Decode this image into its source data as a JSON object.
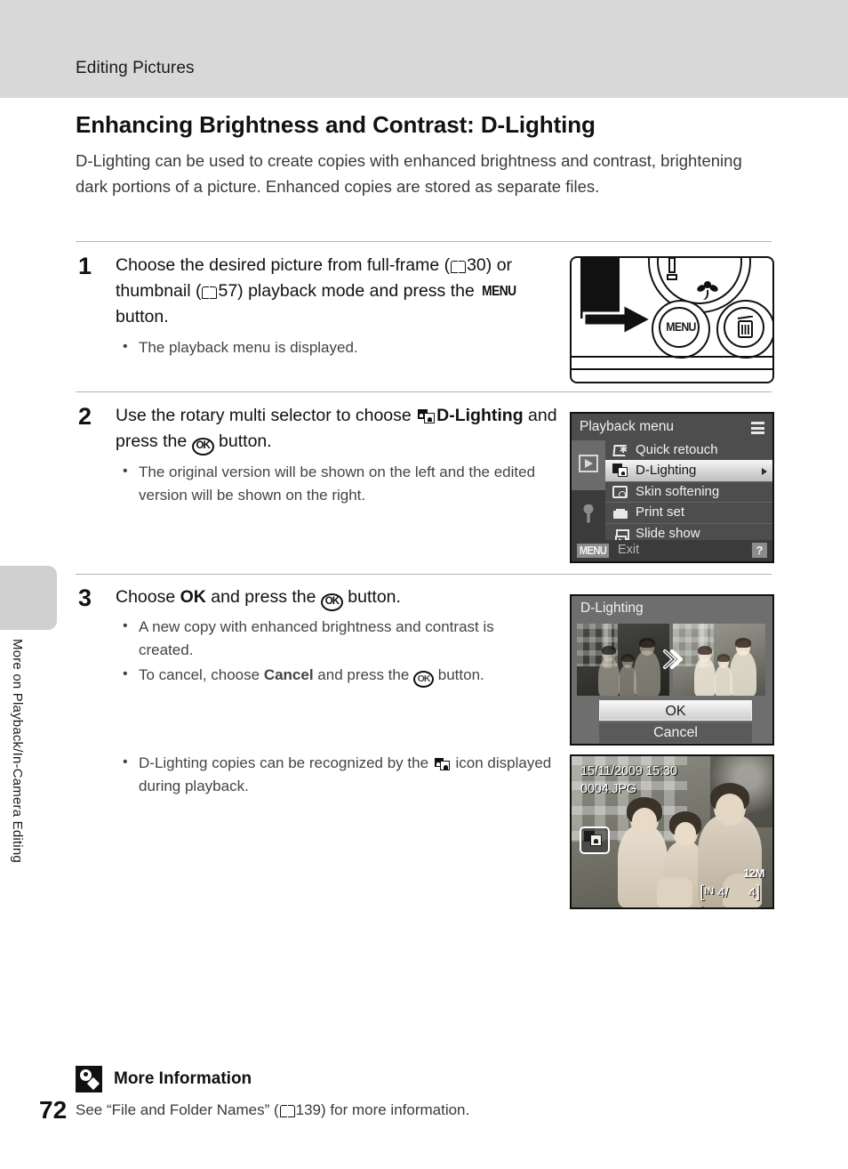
{
  "header": {
    "section_label": "Editing Pictures"
  },
  "page": {
    "number": "72",
    "chapter_tab_label": "More on Playback/In-Camera Editing"
  },
  "article": {
    "title": "Enhancing Brightness and Contrast: D-Lighting",
    "intro": "D-Lighting can be used to create copies with enhanced brightness and contrast, brightening dark portions of a picture. Enhanced copies are stored as separate files."
  },
  "steps": [
    {
      "number": "1",
      "text_part1": "Choose the desired picture from full-frame (",
      "ref1": "30",
      "text_part2": ") or thumbnail (",
      "ref2": "57",
      "text_part3": ") playback mode and press the ",
      "menu_label": "MENU",
      "text_part4": " button.",
      "bullets": [
        "The playback menu is displayed."
      ]
    },
    {
      "number": "2",
      "text_part1": "Use the rotary multi selector to choose ",
      "bold_label": "D-Lighting",
      "text_part2": " and press the ",
      "ok_label": "OK",
      "text_part3": " button.",
      "bullets": [
        "The original version will be shown on the left and the edited version will be shown on the right."
      ]
    },
    {
      "number": "3",
      "text_part1": "Choose ",
      "bold_label": "OK",
      "text_part2": " and press the ",
      "ok_label": "OK",
      "text_part3": " button.",
      "bullets": [
        "A new copy with enhanced brightness and contrast is created.",
        "To cancel, choose Cancel and press the OK button."
      ],
      "bullet2_pre": "To cancel, choose ",
      "bullet2_bold": "Cancel",
      "bullet2_mid": " and press the ",
      "bullet2_post": " button.",
      "extra_bullet_pre": "D-Lighting copies can be recognized by the ",
      "extra_bullet_post": " icon displayed during playback."
    }
  ],
  "camera_illustration": {
    "menu_button_label": "MENU",
    "trash_icon": "trash-icon",
    "macro_icon": "flower-macro-icon",
    "arrow_icon": "right-arrow-icon"
  },
  "playback_menu_screen": {
    "title": "Playback menu",
    "list_icon": "list-lines-icon",
    "sidebar": [
      {
        "icon": "playback-mode-icon",
        "active": true
      },
      {
        "icon": "setup-wrench-icon",
        "active": false
      }
    ],
    "items": [
      {
        "label": "Quick retouch",
        "icon": "quick-retouch-icon",
        "selected": false
      },
      {
        "label": "D-Lighting",
        "icon": "d-lighting-icon",
        "selected": true
      },
      {
        "label": "Skin softening",
        "icon": "skin-softening-icon",
        "selected": false
      },
      {
        "label": "Print set",
        "icon": "print-set-icon",
        "selected": false
      },
      {
        "label": "Slide show",
        "icon": "slide-show-icon",
        "selected": false
      }
    ],
    "footer": {
      "menu_badge": "MENU",
      "exit_label": "Exit",
      "help_badge": "?"
    },
    "colors": {
      "background": "#4d4d4d",
      "selected_row": "#e2e2e2",
      "footer": "#3b3b3b"
    }
  },
  "dlighting_preview_screen": {
    "title": "D-Lighting",
    "arrow_icon": "double-chevron-right-icon",
    "buttons": [
      {
        "label": "OK",
        "selected": true
      },
      {
        "label": "Cancel",
        "selected": false
      }
    ]
  },
  "playback_image_screen": {
    "date": "15/11/2009 15:30",
    "filename": "0004.JPG",
    "dlighting_badge_icon": "d-lighting-icon",
    "image_size": "12M",
    "memory_label": "IN",
    "frame_current": "4",
    "frame_separator": "/",
    "frame_total": "4"
  },
  "more_information": {
    "icon": "lightbulb-icon",
    "title": "More Information",
    "text_pre": "See “File and Folder Names” (",
    "ref": "139",
    "text_post": ") for more information."
  }
}
